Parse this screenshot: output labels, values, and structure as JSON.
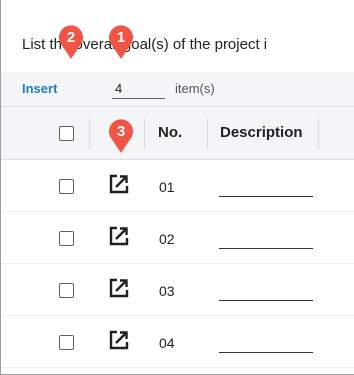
{
  "instruction": {
    "text": "List the overall goal(s) of the project i"
  },
  "toolbar": {
    "insert_label": "Insert",
    "count_value": "4",
    "items_label": "item(s)"
  },
  "table": {
    "headers": {
      "number": "No.",
      "description": "Description"
    },
    "rows": [
      {
        "number": "01",
        "description": ""
      },
      {
        "number": "02",
        "description": ""
      },
      {
        "number": "03",
        "description": ""
      },
      {
        "number": "04",
        "description": ""
      }
    ]
  },
  "annotations": [
    {
      "label": "1",
      "color": "#f05545"
    },
    {
      "label": "2",
      "color": "#f05545"
    },
    {
      "label": "3",
      "color": "#f05545"
    }
  ],
  "icons": {
    "row_action": "edit-external-icon",
    "select": "checkbox"
  }
}
